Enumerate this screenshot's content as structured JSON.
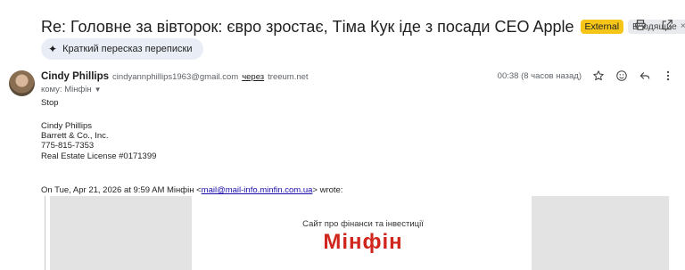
{
  "subject": "Re: Головне за вівторок: євро зростає, Тіма Кук іде з посади CEO Apple",
  "labels": {
    "external": "External",
    "inbox": "Входящие",
    "inbox_close": "×"
  },
  "summary_button": "Краткий пересказ переписки",
  "message": {
    "sender_name": "Cindy Phillips",
    "sender_email": "cindyannphillips1963@gmail.com",
    "via_label": "через",
    "via_domain": "treeum.net",
    "to_line": "кому: Мінфін",
    "time": "00:38 (8 часов назад)",
    "body": {
      "line1": "Stop",
      "sig_name": "Cindy Phillips",
      "sig_company": "Barrett & Co., Inc.",
      "sig_phone": "775-815-7353",
      "sig_license": "Real Estate License #0171399"
    },
    "quote_header_prefix": "On Tue, Apr 21, 2026 at 9:59 AM Мінфін <",
    "quote_header_email": "mail@mail-info.minfin.com.ua",
    "quote_header_suffix": "> wrote:"
  },
  "newsletter": {
    "tagline": "Сайт про фінанси та інвестиції",
    "logo": "Мінфін"
  },
  "icons": {
    "print": "print-icon",
    "open_new": "open-in-new-window-icon",
    "star": "star-icon",
    "emoji": "emoji-reaction-icon",
    "reply": "reply-icon",
    "more": "more-vert-icon",
    "spark": "sparkle-icon"
  },
  "colors": {
    "external_tag": "#f5c518",
    "logo_red": "#d0261d",
    "link": "#1a0dab"
  }
}
